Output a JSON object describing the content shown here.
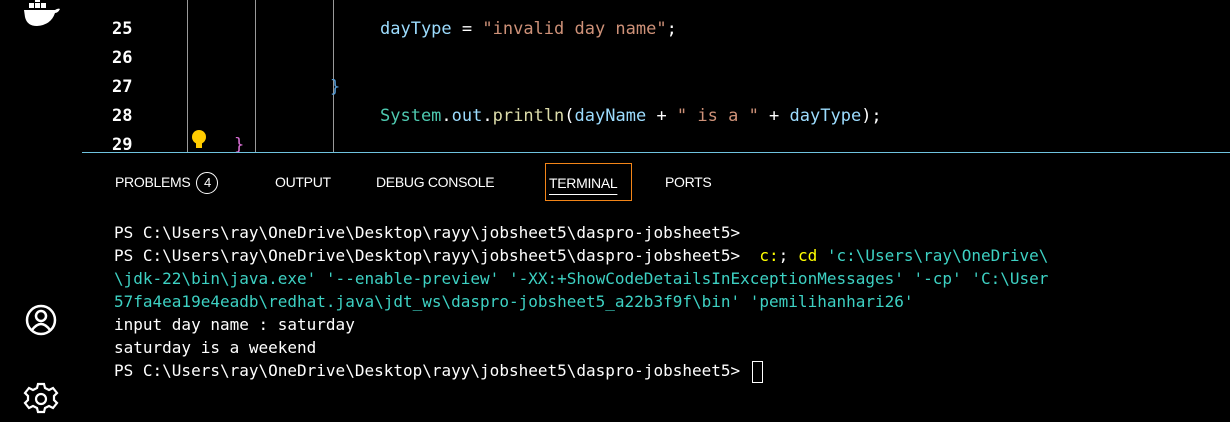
{
  "activity_bar": {
    "items": [
      {
        "name": "docker-icon"
      },
      {
        "name": "accounts-icon"
      },
      {
        "name": "settings-gear-icon"
      }
    ]
  },
  "editor": {
    "lines": [
      {
        "number": "25",
        "tokens": [
          {
            "t": "dayType",
            "c": "#9cdcfe"
          },
          {
            "t": " = ",
            "c": "#ffffff"
          },
          {
            "t": "\"invalid day name\"",
            "c": "#ce9178"
          },
          {
            "t": ";",
            "c": "#ffffff"
          }
        ]
      },
      {
        "number": "26",
        "tokens": []
      },
      {
        "number": "27",
        "tokens": [
          {
            "t": "}",
            "c": "#569cd6"
          }
        ]
      },
      {
        "number": "28",
        "tokens": [
          {
            "t": "System",
            "c": "#4ec9b0"
          },
          {
            "t": ".",
            "c": "#ffffff"
          },
          {
            "t": "out",
            "c": "#9cdcfe"
          },
          {
            "t": ".",
            "c": "#ffffff"
          },
          {
            "t": "println",
            "c": "#dcdcaa"
          },
          {
            "t": "(",
            "c": "#ffffff"
          },
          {
            "t": "dayName",
            "c": "#9cdcfe"
          },
          {
            "t": " + ",
            "c": "#ffffff"
          },
          {
            "t": "\" is a \"",
            "c": "#ce9178"
          },
          {
            "t": " + ",
            "c": "#ffffff"
          },
          {
            "t": "dayType",
            "c": "#9cdcfe"
          },
          {
            "t": ");",
            "c": "#ffffff"
          }
        ]
      },
      {
        "number": "29",
        "tokens": [
          {
            "t": "}",
            "c": "#da70d6"
          }
        ]
      }
    ]
  },
  "panel": {
    "tabs": [
      {
        "label": "PROBLEMS",
        "badge": "4"
      },
      {
        "label": "OUTPUT"
      },
      {
        "label": "DEBUG CONSOLE"
      },
      {
        "label": "TERMINAL"
      },
      {
        "label": "PORTS"
      }
    ],
    "active_tab": "TERMINAL"
  },
  "terminal": {
    "line1": "PS C:\\Users\\ray\\OneDrive\\Desktop\\rayy\\jobsheet5\\daspro-jobsheet5>",
    "line2_prompt": "PS C:\\Users\\ray\\OneDrive\\Desktop\\rayy\\jobsheet5\\daspro-jobsheet5>",
    "line2_cmd1": "c:",
    "line2_sep": "; ",
    "line2_cmd2": "cd",
    "line2_arg": " 'c:\\Users\\ray\\OneDrive\\",
    "line3": "\\jdk-22\\bin\\java.exe' '--enable-preview' '-XX:+ShowCodeDetailsInExceptionMessages' '-cp' 'C:\\User",
    "line4": "57fa4ea19e4eadb\\redhat.java\\jdt_ws\\daspro-jobsheet5_a22b3f9f\\bin' 'pemilihanhari26'",
    "line5": "input day name : saturday",
    "line6": "saturday is a weekend",
    "line7": "PS C:\\Users\\ray\\OneDrive\\Desktop\\rayy\\jobsheet5\\daspro-jobsheet5> "
  }
}
